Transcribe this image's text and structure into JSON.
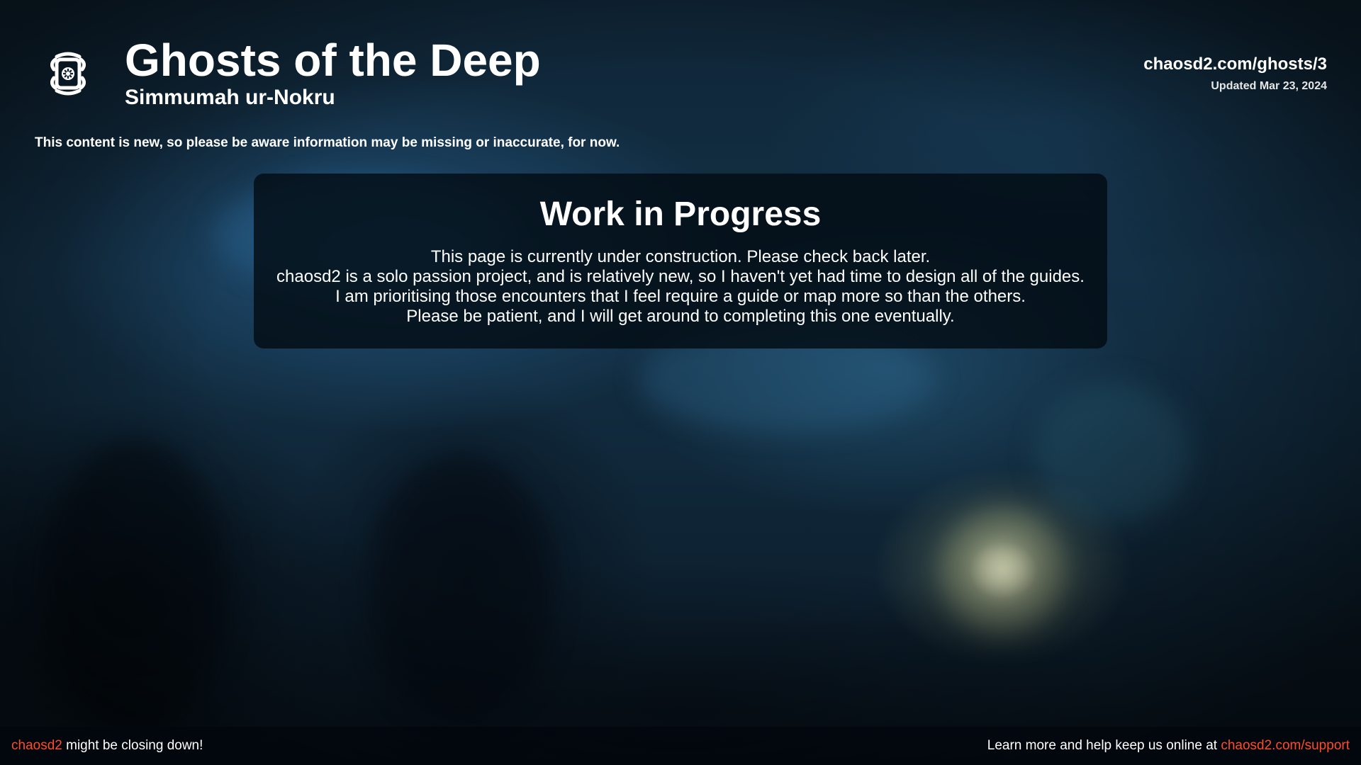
{
  "header": {
    "title": "Ghosts of the Deep",
    "subtitle": "Simmumah ur-Nokru",
    "site_url": "chaosd2.com/ghosts/3",
    "updated": "Updated Mar 23, 2024",
    "logo_icon": "ghost-emblem-icon"
  },
  "notice": "This content is new, so please be aware information may be missing or inaccurate, for now.",
  "wip": {
    "title": "Work in Progress",
    "lines": [
      "This page is currently under construction. Please check back later.",
      "chaosd2 is a solo passion project, and is relatively new, so I haven't yet had time to design all of the guides.",
      "I am prioritising those encounters that I feel require a guide or map more so than the others.",
      "Please be patient, and I will get around to completing this one eventually."
    ]
  },
  "footer": {
    "left_link": "chaosd2",
    "left_text": " might be closing down!",
    "right_text": "Learn more and help keep us online at ",
    "right_link": "chaosd2.com/support"
  },
  "colors": {
    "accent": "#ff4b2b",
    "card_background": "#030c14",
    "footer_background": "#02080e"
  }
}
